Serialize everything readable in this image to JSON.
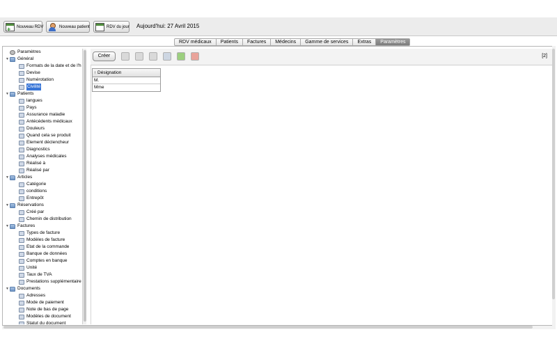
{
  "toolbar": {
    "new_rdv": "Nouveau RDV",
    "new_patient": "Nouveau patient",
    "rdv_du_jour": "RDV du jour",
    "today_text": "Aujourd'hui: 27 Avril 2015"
  },
  "tabs": [
    {
      "label": "RDV médicaux",
      "active": false
    },
    {
      "label": "Patients",
      "active": false
    },
    {
      "label": "Factures",
      "active": false
    },
    {
      "label": "Médecins",
      "active": false
    },
    {
      "label": "Gamme de services",
      "active": false
    },
    {
      "label": "Extras",
      "active": false
    },
    {
      "label": "Paramètres",
      "active": true
    }
  ],
  "tree": [
    {
      "label": "Paramètres",
      "level": 0,
      "type": "root",
      "icon": "gear-icon"
    },
    {
      "label": "Général",
      "level": 1,
      "type": "folder",
      "icon": "folder-icon"
    },
    {
      "label": "Formats de la date et de l'h",
      "level": 2,
      "type": "leaf",
      "icon": "calendar-icon"
    },
    {
      "label": "Devise",
      "level": 2,
      "type": "leaf",
      "icon": "currency-icon"
    },
    {
      "label": "Numérotation",
      "level": 2,
      "type": "leaf",
      "icon": "number-icon"
    },
    {
      "label": "Civilité",
      "level": 2,
      "type": "leaf",
      "icon": "person-icon",
      "selected": true
    },
    {
      "label": "Patients",
      "level": 1,
      "type": "folder",
      "icon": "folder-icon"
    },
    {
      "label": "langues",
      "level": 2,
      "type": "leaf",
      "icon": "globe-icon"
    },
    {
      "label": "Pays",
      "level": 2,
      "type": "leaf",
      "icon": "globe-icon"
    },
    {
      "label": "Assurance maladie",
      "level": 2,
      "type": "leaf",
      "icon": "umbrella-icon"
    },
    {
      "label": "Antécédents médicaux",
      "level": 2,
      "type": "leaf",
      "icon": "syringe-icon"
    },
    {
      "label": "Douleurs",
      "level": 2,
      "type": "leaf",
      "icon": "document-icon"
    },
    {
      "label": "Quand cela se produit",
      "level": 2,
      "type": "leaf",
      "icon": "document-icon"
    },
    {
      "label": "Element déclencheur",
      "level": 2,
      "type": "leaf",
      "icon": "document-icon"
    },
    {
      "label": "Diagnostics",
      "level": 2,
      "type": "leaf",
      "icon": "diagnostic-icon"
    },
    {
      "label": "Analyses médicales",
      "level": 2,
      "type": "leaf",
      "icon": "monitor-icon"
    },
    {
      "label": "Réalisé à",
      "level": 2,
      "type": "leaf",
      "icon": "building-icon"
    },
    {
      "label": "Réalisé par",
      "level": 2,
      "type": "leaf",
      "icon": "person-icon"
    },
    {
      "label": "Articles",
      "level": 1,
      "type": "folder",
      "icon": "folder-icon"
    },
    {
      "label": "Catégorie",
      "level": 2,
      "type": "leaf",
      "icon": "category-icon"
    },
    {
      "label": "conditions",
      "level": 2,
      "type": "leaf",
      "icon": "tree-icon"
    },
    {
      "label": "Entrepôt",
      "level": 2,
      "type": "leaf",
      "icon": "warehouse-icon"
    },
    {
      "label": "Réservations",
      "level": 1,
      "type": "folder",
      "icon": "folder-icon"
    },
    {
      "label": "Créé par",
      "level": 2,
      "type": "leaf",
      "icon": "people-icon"
    },
    {
      "label": "Chemin de distribution",
      "level": 2,
      "type": "leaf",
      "icon": "chart-icon"
    },
    {
      "label": "Factures",
      "level": 1,
      "type": "folder",
      "icon": "folder-icon"
    },
    {
      "label": "Types de facture",
      "level": 2,
      "type": "leaf",
      "icon": "invoice-icon"
    },
    {
      "label": "Modèles de facture",
      "level": 2,
      "type": "leaf",
      "icon": "template-icon"
    },
    {
      "label": "Etat de la commande",
      "level": 2,
      "type": "leaf",
      "icon": "warning-icon"
    },
    {
      "label": "Banque de données",
      "level": 2,
      "type": "leaf",
      "icon": "database-icon"
    },
    {
      "label": "Comptes en banque",
      "level": 2,
      "type": "leaf",
      "icon": "coins-icon"
    },
    {
      "label": "Unité",
      "level": 2,
      "type": "leaf",
      "icon": "unit-icon"
    },
    {
      "label": "Taux de TVA",
      "level": 2,
      "type": "leaf",
      "icon": "percent-icon"
    },
    {
      "label": "Prestations supplémentaire",
      "level": 2,
      "type": "leaf",
      "icon": "invoice-icon"
    },
    {
      "label": "Documents",
      "level": 1,
      "type": "folder",
      "icon": "folder-icon"
    },
    {
      "label": "Adresses",
      "level": 2,
      "type": "leaf",
      "icon": "address-book-icon"
    },
    {
      "label": "Mode de paiement",
      "level": 2,
      "type": "leaf",
      "icon": "payment-icon"
    },
    {
      "label": "Note de bas de page",
      "level": 2,
      "type": "leaf",
      "icon": "note-icon"
    },
    {
      "label": "Modèles de document",
      "level": 2,
      "type": "leaf",
      "icon": "template-icon"
    },
    {
      "label": "Statut du document",
      "level": 2,
      "type": "leaf",
      "icon": "warning-icon"
    }
  ],
  "panel": {
    "create_label": "Créer",
    "count": "[2]",
    "column_header": "↑ Désignation",
    "rows": [
      "M.",
      "Mme"
    ]
  },
  "colors": {
    "selection": "#3875d7",
    "active_tab": "#8a8a8a",
    "green": "#4f8d3c"
  }
}
